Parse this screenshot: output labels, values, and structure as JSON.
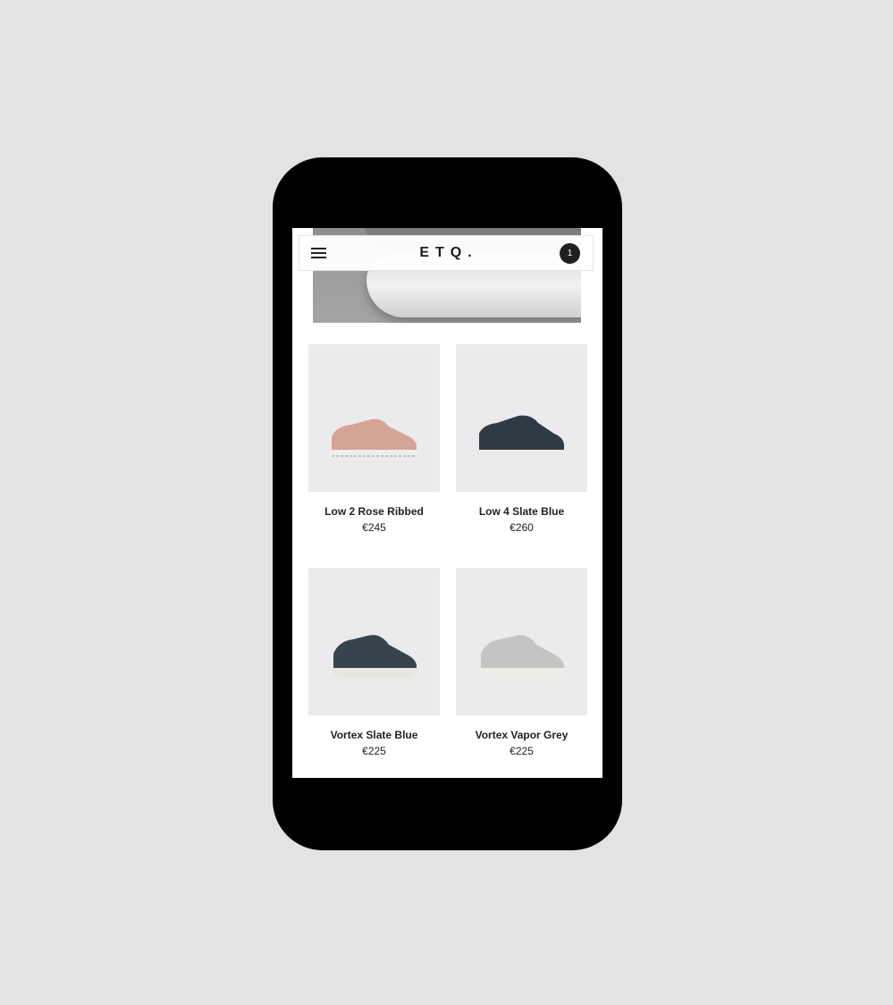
{
  "header": {
    "logo": "ETQ.",
    "cart_count": "1"
  },
  "products": [
    {
      "name": "Low 2 Rose Ribbed",
      "price": "€245",
      "color": "#d4a497"
    },
    {
      "name": "Low 4 Slate Blue",
      "price": "€260",
      "color": "#2f3b44"
    },
    {
      "name": "Vortex Slate Blue",
      "price": "€225",
      "color": "#39434c"
    },
    {
      "name": "Vortex Vapor Grey",
      "price": "€225",
      "color": "#c4c5c3"
    }
  ]
}
